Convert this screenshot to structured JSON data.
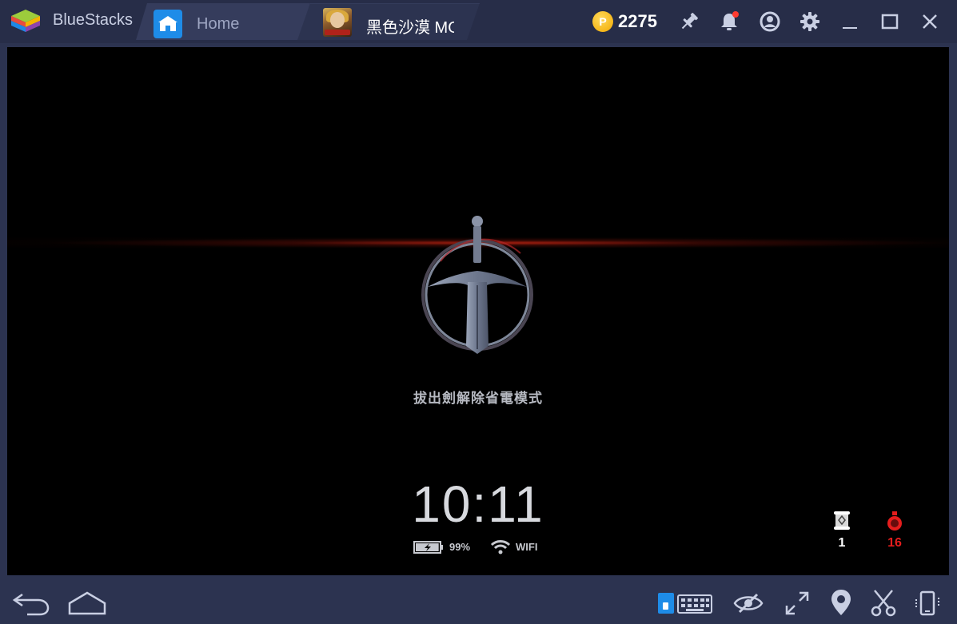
{
  "window": {
    "brand": "BlueStacks",
    "colors": {
      "titlebar": "#272d48",
      "frame": "#2c3350",
      "accent": "#1e8ce8"
    }
  },
  "tabs": [
    {
      "label": "Home",
      "icon": "home-icon",
      "active": false
    },
    {
      "label": "黑色沙漠 MO",
      "icon": "game-app-icon",
      "active": true
    }
  ],
  "toolbar": {
    "coins": "2275",
    "coin_icon": "p-coin-icon",
    "icons": [
      "pin-icon",
      "notification-bell-icon",
      "account-icon",
      "settings-gear-icon",
      "minimize-icon",
      "maximize-icon",
      "close-icon"
    ],
    "notification_dot": true
  },
  "game": {
    "emblem": "sword-in-circle-icon",
    "prompt": "拔出劍解除省電模式",
    "time": "10:11",
    "battery_text": "99%",
    "battery_level": 0.99,
    "network_text": "WIFI",
    "items": [
      {
        "icon": "scroll-icon",
        "count": "1",
        "color": "#ffffff"
      },
      {
        "icon": "red-potion-icon",
        "count": "16",
        "color": "#e51d1d"
      }
    ]
  },
  "bottombar": {
    "left_icons": [
      "back-arrow-icon",
      "home-outline-icon"
    ],
    "right_icons": [
      "keyboard-controls-icon",
      "eye-toggle-icon",
      "fullscreen-icon",
      "location-pin-icon",
      "scissors-icon",
      "rotate-device-icon"
    ]
  }
}
